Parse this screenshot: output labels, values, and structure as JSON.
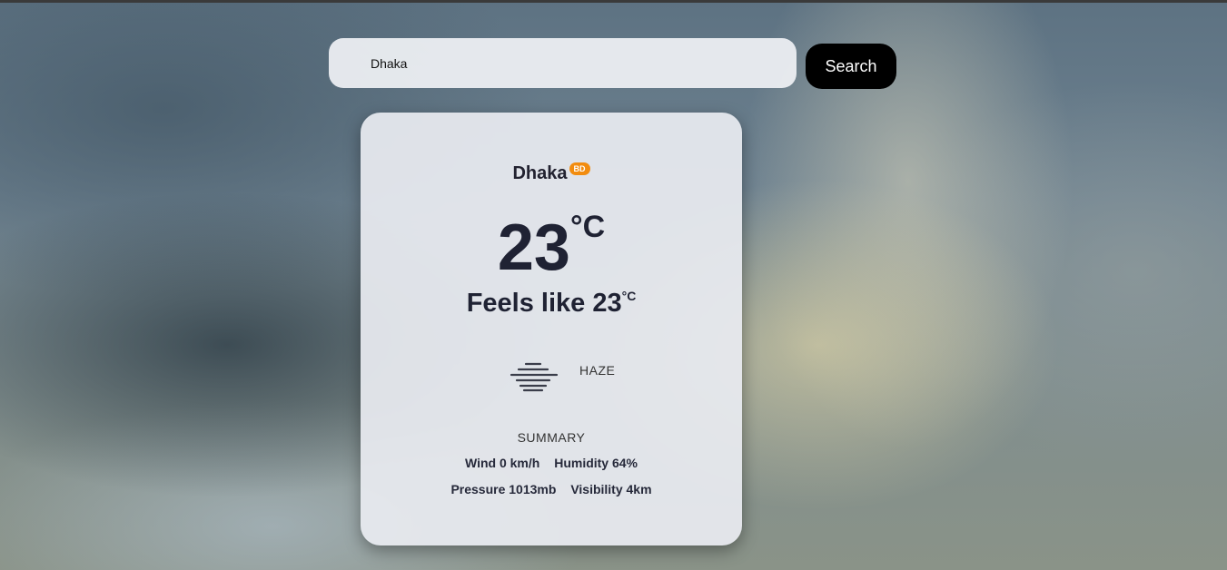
{
  "search": {
    "value": "Dhaka",
    "button_label": "Search"
  },
  "weather": {
    "city": "Dhaka",
    "country_code": "BD",
    "temperature": "23",
    "temperature_unit": "°C",
    "feels_like_label": "Feels like 23",
    "feels_like_unit": "°C",
    "condition_icon": "haze-icon",
    "condition": "HAZE",
    "summary_title": "SUMMARY",
    "wind": "Wind 0 km/h",
    "humidity": "Humidity 64%",
    "pressure": "Pressure 1013mb",
    "visibility": "Visibility 4km"
  },
  "colors": {
    "badge": "#f28c0f",
    "button": "#000000",
    "card_text": "#1f2233"
  }
}
